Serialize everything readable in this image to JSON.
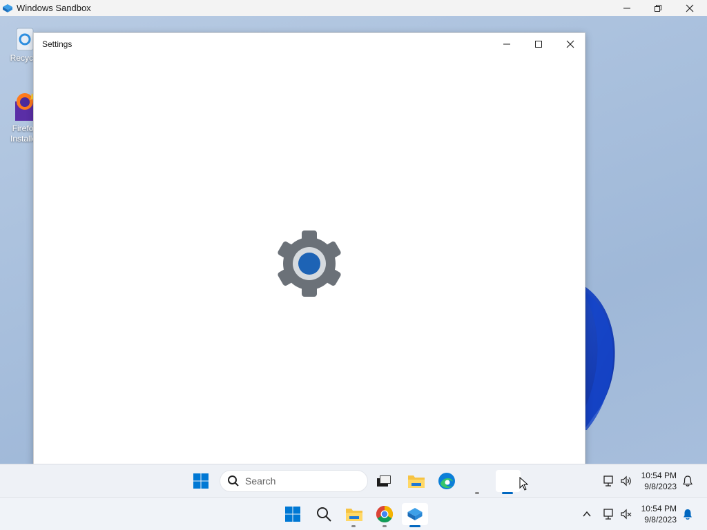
{
  "host": {
    "title": "Windows Sandbox",
    "controls": {
      "minimize": "minimize",
      "restore": "restore",
      "close": "close"
    }
  },
  "desktop": {
    "icons": [
      {
        "label": "Recycle",
        "icon": "recycle-bin-icon"
      },
      {
        "label": "Firefox Installer",
        "icon": "firefox-installer-icon"
      }
    ]
  },
  "settings_window": {
    "title": "Settings",
    "splash_icon": "gear-icon",
    "colors": {
      "gear": "#6b7178",
      "accent": "#1d63b5"
    }
  },
  "inner_taskbar": {
    "search_placeholder": "Search",
    "apps": [
      "start-icon",
      "search-box",
      "task-view-icon",
      "file-explorer-icon",
      "edge-icon",
      "settings-app-button"
    ],
    "clock": {
      "time": "10:54 PM",
      "date": "9/8/2023"
    }
  },
  "host_taskbar": {
    "apps": [
      "start-icon",
      "search-icon",
      "file-explorer-icon",
      "chrome-icon",
      "windows-sandbox-icon"
    ],
    "clock": {
      "time": "10:54 PM",
      "date": "9/8/2023"
    }
  },
  "colors": {
    "wallpaper": "#a9c0dd",
    "bloom": "#1a3fb8",
    "accent_blue": "#0067c0"
  }
}
